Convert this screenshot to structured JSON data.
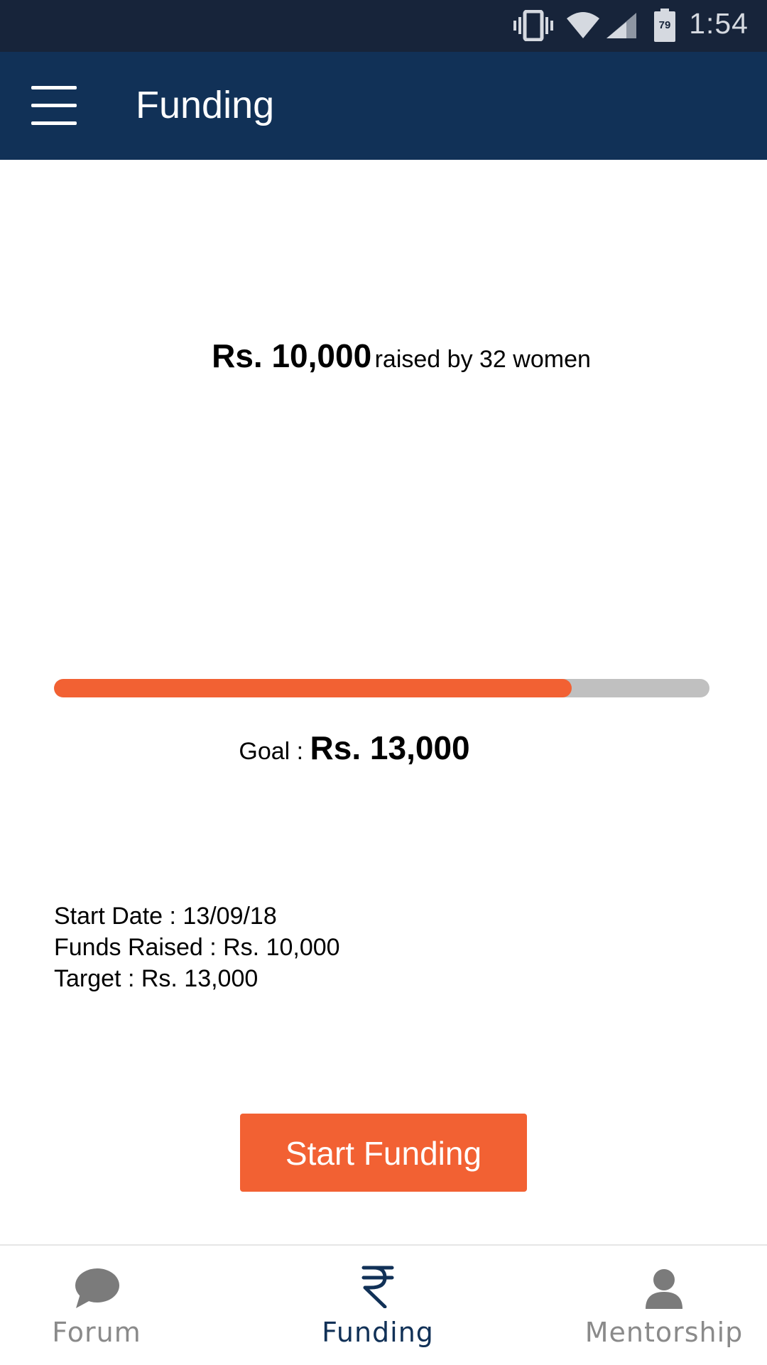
{
  "status_bar": {
    "time": "1:54",
    "battery_level": "79",
    "icons": [
      "vibrate-icon",
      "wifi-icon",
      "cell-signal-icon",
      "battery-icon"
    ]
  },
  "app_bar": {
    "title": "Funding",
    "menu_icon": "hamburger-menu-icon"
  },
  "summary": {
    "raised_amount": "Rs. 10,000",
    "raised_text": "raised by 32 women"
  },
  "progress": {
    "fraction": 0.79
  },
  "goal": {
    "label": "Goal : ",
    "amount": "Rs. 13,000"
  },
  "details": {
    "start_date": "Start Date : 13/09/18",
    "funds_raised": "Funds Raised : Rs. 10,000",
    "target": "Target : Rs. 13,000"
  },
  "actions": {
    "start_funding_label": "Start Funding"
  },
  "bottom_nav": {
    "items": [
      {
        "label": "Forum",
        "icon": "chat-bubble-icon",
        "active": false
      },
      {
        "label": "Funding",
        "icon": "rupee-icon",
        "active": true
      },
      {
        "label": "Mentorship",
        "icon": "person-icon",
        "active": false
      }
    ]
  },
  "colors": {
    "status_bar": "#17243a",
    "app_bar": "#113157",
    "accent": "#f26133",
    "track": "#c0c0c0",
    "nav_inactive": "#8a8a8a"
  }
}
